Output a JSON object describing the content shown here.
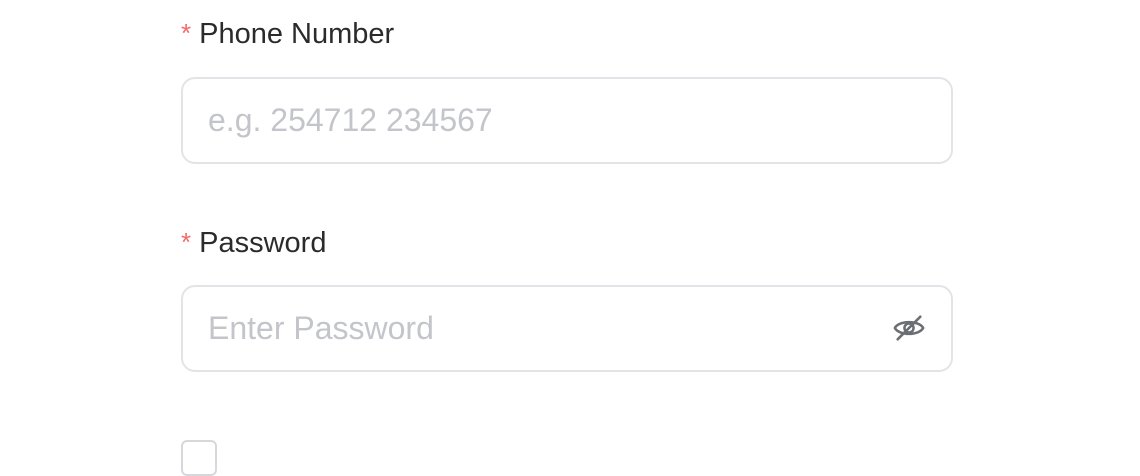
{
  "form": {
    "phone": {
      "required_mark": "*",
      "label": "Phone Number",
      "value": "",
      "placeholder": "e.g. 254712 234567"
    },
    "password": {
      "required_mark": "*",
      "label": "Password",
      "value": "",
      "placeholder": "Enter Password",
      "toggle_icon": "eye-slash-icon"
    }
  },
  "colors": {
    "required": "#f26a6a",
    "label_text": "#2b2b2b",
    "placeholder": "#c3c5ca",
    "input_border": "#e3e4e7",
    "icon": "#6b6e73"
  }
}
